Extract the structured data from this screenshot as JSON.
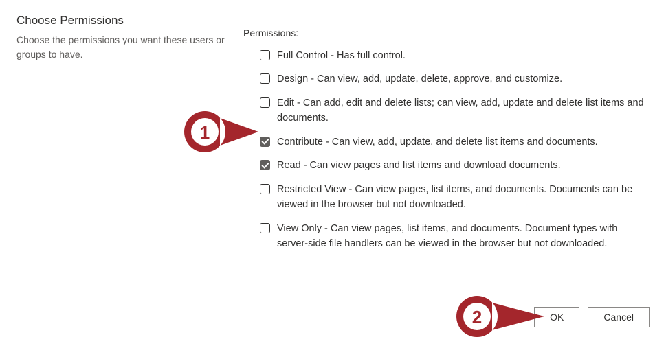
{
  "section": {
    "title": "Choose Permissions",
    "description": "Choose the permissions you want these users or groups to have."
  },
  "permissions": {
    "label": "Permissions:",
    "items": [
      {
        "label": "Full Control - Has full control.",
        "checked": false
      },
      {
        "label": "Design - Can view, add, update, delete, approve, and customize.",
        "checked": false
      },
      {
        "label": "Edit - Can add, edit and delete lists; can view, add, update and delete list items and documents.",
        "checked": false
      },
      {
        "label": "Contribute - Can view, add, update, and delete list items and documents.",
        "checked": true
      },
      {
        "label": "Read - Can view pages and list items and download documents.",
        "checked": true
      },
      {
        "label": "Restricted View - Can view pages, list items, and documents. Documents can be viewed in the browser but not downloaded.",
        "checked": false
      },
      {
        "label": "View Only - Can view pages, list items, and documents. Document types with server-side file handlers can be viewed in the browser but not downloaded.",
        "checked": false
      }
    ]
  },
  "buttons": {
    "ok": "OK",
    "cancel": "Cancel"
  },
  "callouts": {
    "one": "1",
    "two": "2"
  },
  "colors": {
    "accent": "#a4262c",
    "checkbox_fill": "#605e5c"
  }
}
